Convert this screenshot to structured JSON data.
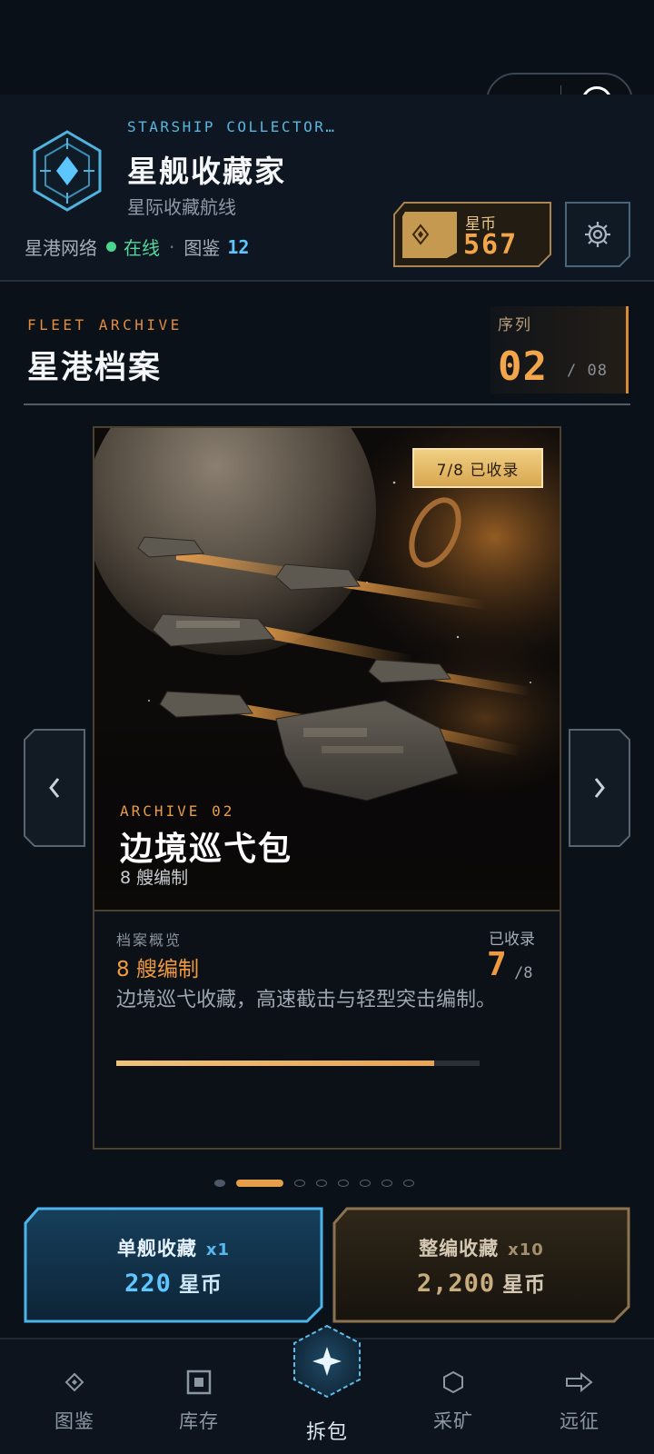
{
  "header": {
    "app_name_en": "STARSHIP COLLECTOR…",
    "app_name": "星舰收藏家",
    "app_subtitle": "星际收藏航线",
    "network_label": "星港网络",
    "status_text": "在线",
    "separator": "·",
    "catalog_label": "图鉴",
    "catalog_count": "12",
    "coin_label": "星币",
    "coin_value": "567",
    "icons": [
      "diamond-emblem-icon",
      "coin-diamond-icon",
      "gear-icon",
      "more-dots-icon",
      "close-circle-icon"
    ]
  },
  "section": {
    "title_en": "FLEET ARCHIVE",
    "title": "星港档案",
    "sequence_label": "序列",
    "sequence_current": "02",
    "sequence_total": "/ 08"
  },
  "card": {
    "collected_tag": "7/8 已收录",
    "archive_en": "ARCHIVE 02",
    "title": "边境巡弋包",
    "subtitle": "8 艘编制",
    "overview_label": "档案概览",
    "overview_count": "8 艘编制",
    "collected_label": "已收录",
    "collected_num": "7",
    "collected_total": "/8",
    "description": "边境巡弋收藏，高速截击与轻型突击编制。",
    "progress": 0.875
  },
  "carousel": {
    "prev_icon": "chevron-left-icon",
    "next_icon": "chevron-right-icon",
    "total_pages": 8,
    "active_index": 1
  },
  "actions": {
    "single": {
      "title": "单舰收藏",
      "multiplier": "x1",
      "price": "220",
      "unit": "星币"
    },
    "multi": {
      "title": "整编收藏",
      "multiplier": "x10",
      "price": "2,200",
      "unit": "星币"
    }
  },
  "nav": {
    "items": [
      {
        "label": "图鉴",
        "icon": "diamond-outline-icon"
      },
      {
        "label": "库存",
        "icon": "square-box-icon"
      },
      {
        "label": "拆包",
        "icon": "sparkle-hexagon-icon"
      },
      {
        "label": "采矿",
        "icon": "hexagon-icon"
      },
      {
        "label": "远征",
        "icon": "arrow-right-icon"
      }
    ],
    "active_index": 2
  },
  "colors": {
    "accent_orange": "#f2a54a",
    "accent_blue": "#5cc6ff",
    "online_green": "#4bd58d",
    "background": "#0b1119"
  }
}
